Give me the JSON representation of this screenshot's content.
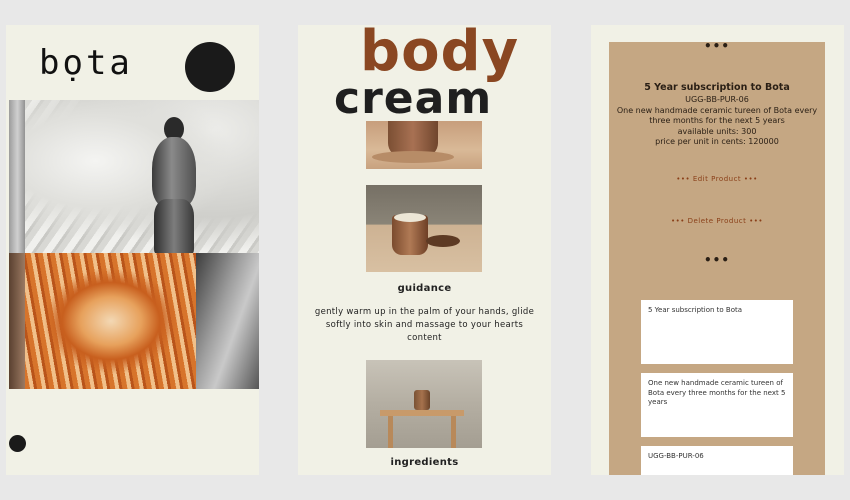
{
  "brand": {
    "logo_text": "bọta"
  },
  "hero": {
    "line1": "body",
    "line2": "cream"
  },
  "guidance": {
    "heading": "guidance",
    "text": "gently warm up in the palm of your hands, glide softly into skin and massage to your hearts content"
  },
  "ingredients": {
    "heading": "ingredients"
  },
  "product": {
    "menu_dots": "•••",
    "title": "5 Year subscription to Bota",
    "sku": "UGG-BB-PUR-06",
    "description": "One new handmade ceramic tureen of Bota every three months for the next 5 years",
    "available_units": "available units: 300",
    "price": "price per unit in cents: 120000",
    "edit_label": "••• Edit Product •••",
    "delete_label": "••• Delete Product •••",
    "section_dots": "•••"
  },
  "form": {
    "title_value": "5 Year subscription to Bota",
    "description_value": "One new handmade ceramic tureen of Bota every three months for the next 5 years",
    "sku_value": "UGG-BB-PUR-06"
  },
  "colors": {
    "accent_brown": "#8a4722",
    "card_tan": "#c5a783",
    "panel_bg": "#f1f1e6"
  }
}
